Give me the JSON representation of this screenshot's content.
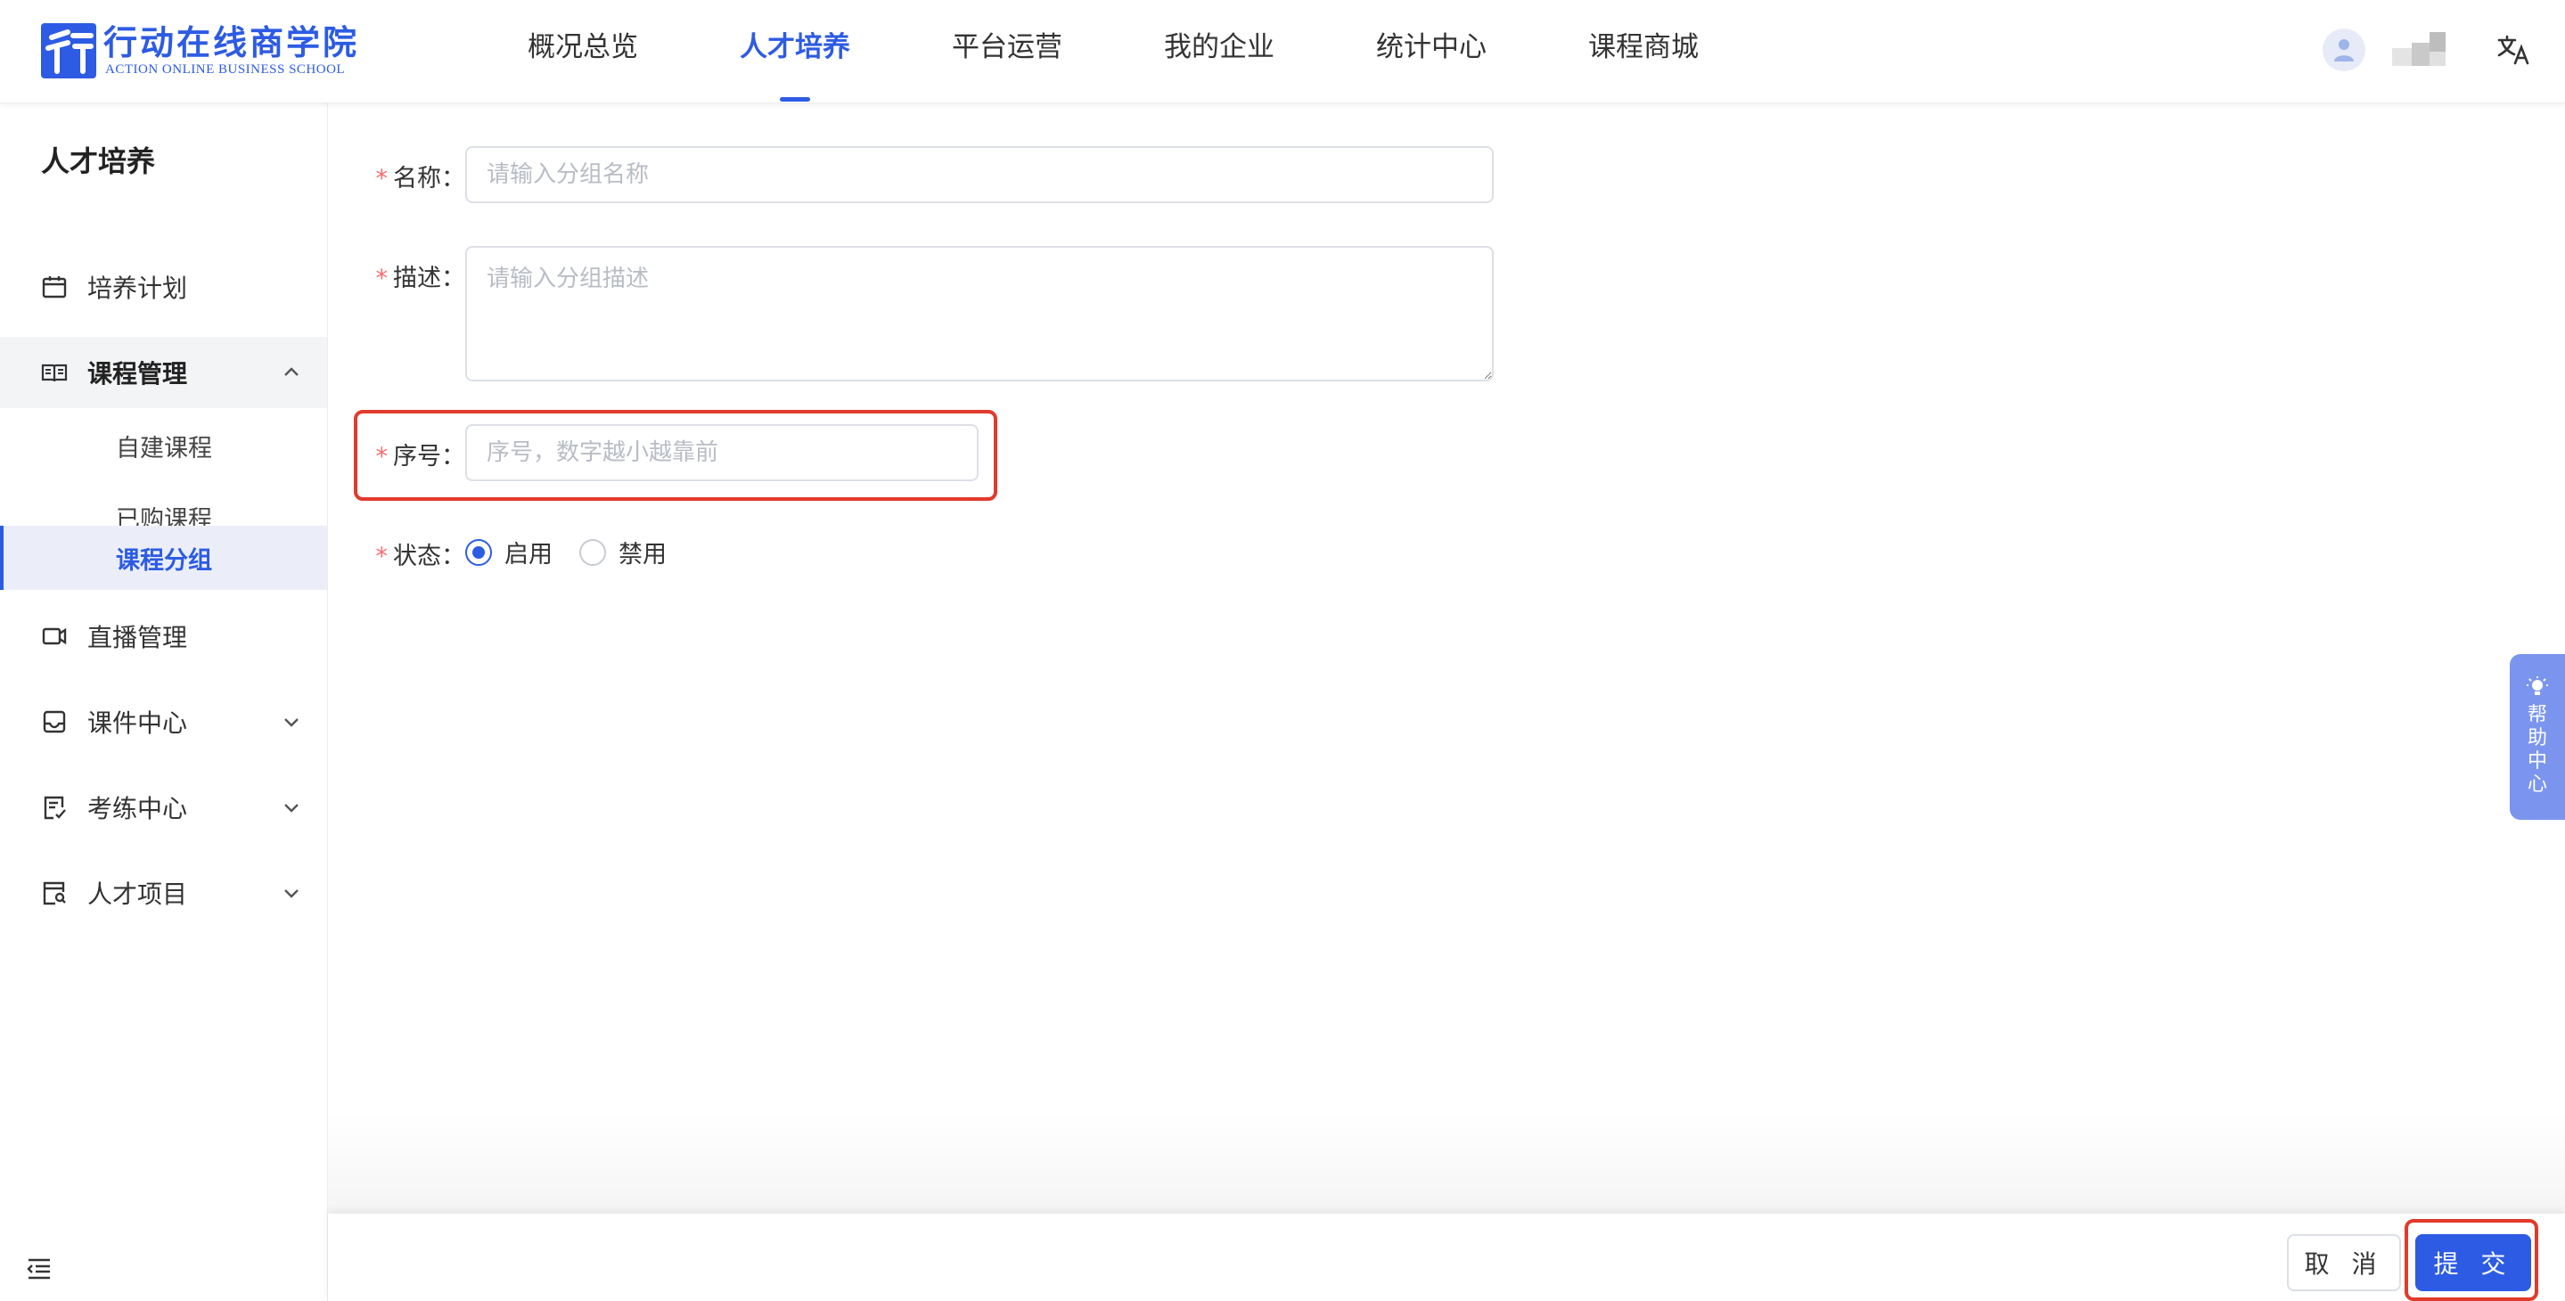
{
  "header": {
    "logo_cn": "行动在线商学院",
    "logo_en": "ACTION ONLINE BUSINESS SCHOOL",
    "nav": [
      {
        "label": "概况总览",
        "active": false
      },
      {
        "label": "人才培养",
        "active": true
      },
      {
        "label": "平台运营",
        "active": false
      },
      {
        "label": "我的企业",
        "active": false
      },
      {
        "label": "统计中心",
        "active": false
      },
      {
        "label": "课程商城",
        "active": false
      }
    ]
  },
  "sidebar": {
    "title": "人才培养",
    "items": [
      {
        "label": "培养计划",
        "icon": "calendar-icon"
      },
      {
        "label": "课程管理",
        "icon": "book-icon",
        "expanded": true,
        "children": [
          {
            "label": "自建课程"
          },
          {
            "label": "已购课程"
          },
          {
            "label": "课程分组",
            "active": true
          }
        ]
      },
      {
        "label": "直播管理",
        "icon": "video-icon"
      },
      {
        "label": "课件中心",
        "icon": "inbox-icon"
      },
      {
        "label": "考练中心",
        "icon": "exam-icon"
      },
      {
        "label": "人才项目",
        "icon": "project-icon"
      }
    ]
  },
  "form": {
    "name": {
      "label": "名称",
      "placeholder": "请输入分组名称",
      "value": ""
    },
    "desc": {
      "label": "描述",
      "placeholder": "请输入分组描述",
      "value": ""
    },
    "order": {
      "label": "序号",
      "placeholder": "序号，数字越小越靠前",
      "value": ""
    },
    "status": {
      "label": "状态",
      "options": [
        "启用",
        "禁用"
      ],
      "selected": "启用"
    },
    "colon": "："
  },
  "help": {
    "label": "帮助中心"
  },
  "footer": {
    "cancel_label": "取 消",
    "submit_label": "提 交"
  },
  "colors": {
    "accent": "#2d5be3",
    "highlight": "#e23a2b",
    "required": "#f56c6c",
    "help_tab": "#7b95ee"
  }
}
